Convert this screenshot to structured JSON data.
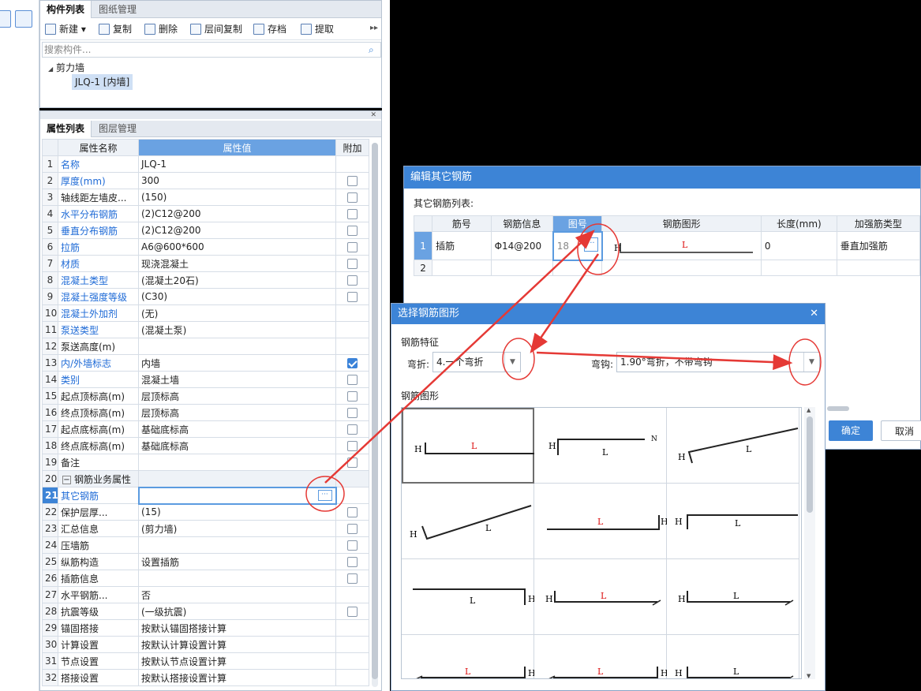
{
  "top_panel": {
    "tabs": [
      "构件列表",
      "图纸管理"
    ],
    "toolbar": [
      "新建",
      "复制",
      "删除",
      "层间复制",
      "存档",
      "提取"
    ],
    "search_placeholder": "搜索构件...",
    "tree_group": "剪力墙",
    "tree_item": "JLQ-1 [内墙]"
  },
  "prop_panel": {
    "tabs": [
      "属性列表",
      "图层管理"
    ],
    "headers": [
      "属性名称",
      "属性值",
      "附加"
    ],
    "rows": [
      {
        "n": "1",
        "name": "名称",
        "value": "JLQ-1",
        "blue": true,
        "cb": ""
      },
      {
        "n": "2",
        "name": "厚度(mm)",
        "value": "300",
        "blue": true,
        "cb": "off"
      },
      {
        "n": "3",
        "name": "轴线距左墙皮...",
        "value": "(150)",
        "blue": false,
        "cb": "off"
      },
      {
        "n": "4",
        "name": "水平分布钢筋",
        "value": "(2)C12@200",
        "blue": true,
        "cb": "off"
      },
      {
        "n": "5",
        "name": "垂直分布钢筋",
        "value": "(2)C12@200",
        "blue": true,
        "cb": "off"
      },
      {
        "n": "6",
        "name": "拉筋",
        "value": "A6@600*600",
        "blue": true,
        "cb": "off"
      },
      {
        "n": "7",
        "name": "材质",
        "value": "现浇混凝土",
        "blue": true,
        "cb": "off"
      },
      {
        "n": "8",
        "name": "混凝土类型",
        "value": "(混凝土20石)",
        "blue": true,
        "cb": "off"
      },
      {
        "n": "9",
        "name": "混凝土强度等级",
        "value": "(C30)",
        "blue": true,
        "cb": "off"
      },
      {
        "n": "10",
        "name": "混凝土外加剂",
        "value": "(无)",
        "blue": true,
        "cb": ""
      },
      {
        "n": "11",
        "name": "泵送类型",
        "value": "(混凝土泵)",
        "blue": true,
        "cb": ""
      },
      {
        "n": "12",
        "name": "泵送高度(m)",
        "value": "",
        "blue": false,
        "cb": ""
      },
      {
        "n": "13",
        "name": "内/外墙标志",
        "value": "内墙",
        "blue": true,
        "cb": "on"
      },
      {
        "n": "14",
        "name": "类别",
        "value": "混凝土墙",
        "blue": true,
        "cb": "off"
      },
      {
        "n": "15",
        "name": "起点顶标高(m)",
        "value": "层顶标高",
        "blue": false,
        "cb": "off"
      },
      {
        "n": "16",
        "name": "终点顶标高(m)",
        "value": "层顶标高",
        "blue": false,
        "cb": "off"
      },
      {
        "n": "17",
        "name": "起点底标高(m)",
        "value": "基础底标高",
        "blue": false,
        "cb": "off"
      },
      {
        "n": "18",
        "name": "终点底标高(m)",
        "value": "基础底标高",
        "blue": false,
        "cb": "off"
      },
      {
        "n": "19",
        "name": "备注",
        "value": "",
        "blue": false,
        "cb": "off"
      },
      {
        "n": "20",
        "name": "钢筋业务属性",
        "value": "",
        "blue": false,
        "cb": "",
        "group": true
      },
      {
        "n": "21",
        "name": "其它钢筋",
        "value": "",
        "blue": true,
        "cb": "",
        "sub": true,
        "active": true
      },
      {
        "n": "22",
        "name": "保护层厚...",
        "value": "(15)",
        "blue": false,
        "cb": "off",
        "sub": true
      },
      {
        "n": "23",
        "name": "汇总信息",
        "value": "(剪力墙)",
        "blue": false,
        "cb": "off",
        "sub": true
      },
      {
        "n": "24",
        "name": "压墙筋",
        "value": "",
        "blue": false,
        "cb": "off",
        "sub": true
      },
      {
        "n": "25",
        "name": "纵筋构造",
        "value": "设置插筋",
        "blue": false,
        "cb": "off",
        "sub": true
      },
      {
        "n": "26",
        "name": "插筋信息",
        "value": "",
        "blue": false,
        "cb": "off",
        "sub": true
      },
      {
        "n": "27",
        "name": "水平钢筋...",
        "value": "否",
        "blue": false,
        "cb": "",
        "sub": true
      },
      {
        "n": "28",
        "name": "抗震等级",
        "value": "(一级抗震)",
        "blue": false,
        "cb": "off",
        "sub": true
      },
      {
        "n": "29",
        "name": "锚固搭接",
        "value": "按默认锚固搭接计算",
        "blue": false,
        "cb": "",
        "sub": true
      },
      {
        "n": "30",
        "name": "计算设置",
        "value": "按默认计算设置计算",
        "blue": false,
        "cb": "",
        "sub": true
      },
      {
        "n": "31",
        "name": "节点设置",
        "value": "按默认节点设置计算",
        "blue": false,
        "cb": "",
        "sub": true
      },
      {
        "n": "32",
        "name": "搭接设置",
        "value": "按默认搭接设置计算",
        "blue": false,
        "cb": "",
        "sub": true
      }
    ]
  },
  "edit_dialog": {
    "title": "编辑其它钢筋",
    "list_label": "其它钢筋列表:",
    "headers": [
      "筋号",
      "钢筋信息",
      "图号",
      "钢筋图形",
      "长度(mm)",
      "加强筋类型"
    ],
    "rows": [
      {
        "n": "1",
        "name": "插筋",
        "info": "Φ14@200",
        "fig": "18",
        "len": "0",
        "type": "垂直加强筋"
      },
      {
        "n": "2",
        "name": "",
        "info": "",
        "fig": "",
        "len": "",
        "type": ""
      }
    ],
    "ok": "确定",
    "cancel": "取消"
  },
  "select_dialog": {
    "title": "选择钢筋图形",
    "feature_label": "钢筋特征",
    "bend_label": "弯折:",
    "bend_value": "4.一个弯折",
    "hook_label": "弯钩:",
    "hook_value": "1.90°弯折，不带弯钩",
    "shape_label": "钢筋图形"
  },
  "colors": {
    "accent": "#3d84d6",
    "annotation": "#e53935"
  }
}
